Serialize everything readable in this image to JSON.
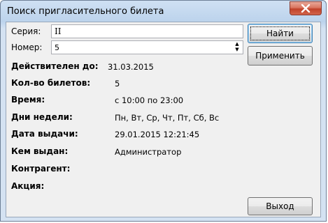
{
  "window": {
    "title": "Поиск пригласительного билета"
  },
  "form": {
    "series_label": "Серия:",
    "series_value": "II",
    "number_label": "Номер:",
    "number_value": "5"
  },
  "buttons": {
    "find": "Найти",
    "apply": "Применить",
    "exit": "Выход"
  },
  "details": [
    {
      "label": "Действителен до:",
      "value": "31.03.2015"
    },
    {
      "label": "Кол-во билетов:",
      "value": "5"
    },
    {
      "label": "Время:",
      "value": "с 10:00 по 23:00"
    },
    {
      "label": "Дни недели:",
      "value": "Пн, Вт, Ср, Чт, Пт, Сб, Вс"
    },
    {
      "label": "Дата выдачи:",
      "value": "29.01.2015 12:21:45"
    },
    {
      "label": "Кем выдан:",
      "value": "Администратор"
    },
    {
      "label": "Контрагент:",
      "value": ""
    },
    {
      "label": "Акция:",
      "value": ""
    }
  ],
  "icons": {
    "close": "close-icon",
    "spin_up": "spin-up-icon",
    "spin_down": "spin-down-icon"
  }
}
